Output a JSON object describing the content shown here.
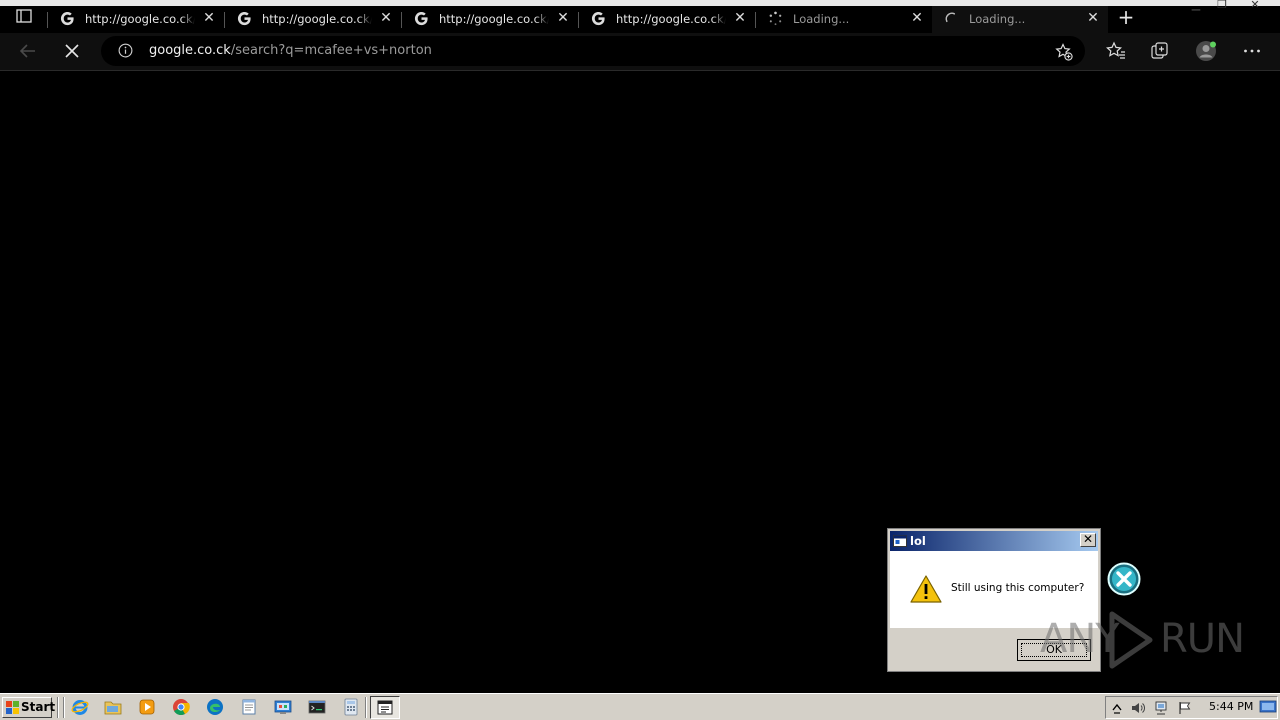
{
  "browser": {
    "tabs": [
      {
        "title": "http://google.co.ck/search?q=mcafee+vs+norton",
        "icon": "google-icon",
        "state": "loaded"
      },
      {
        "title": "http://google.co.ck/search?q=mcafee+vs+norton",
        "icon": "google-icon",
        "state": "loaded"
      },
      {
        "title": "http://google.co.ck/search?q=mcafee+vs+norton",
        "icon": "google-icon",
        "state": "loaded"
      },
      {
        "title": "http://google.co.ck/search?q=mcafee+vs+norton",
        "icon": "google-icon",
        "state": "loaded"
      },
      {
        "title": "Loading...",
        "icon": "loading-dots-icon",
        "state": "loading"
      },
      {
        "title": "Loading...",
        "icon": "loading-spinner-icon",
        "state": "loading",
        "active": true
      }
    ],
    "new_tab_label": "+",
    "address": {
      "host": "google.co.ck",
      "path": "/search?q=mcafee+vs+norton"
    },
    "colors": {
      "chrome_bg": "#0f0f0f",
      "page_bg": "#000000",
      "text": "#e6e6e6"
    }
  },
  "dialog": {
    "title": "lol",
    "message": "Still using this computer?",
    "ok_label": "OK",
    "close_glyph": "✕",
    "icon": "warning-icon",
    "colors": {
      "titlebar_start": "#0a246a",
      "titlebar_end": "#a6caf0",
      "face": "#d4d0c8"
    }
  },
  "watermark": {
    "left": "ANY",
    "right": "RUN"
  },
  "taskbar": {
    "start_label": "Start",
    "quick_launch": [
      "ie-icon",
      "folder-icon",
      "media-player-icon",
      "chrome-icon",
      "edge-icon",
      "notepad-icon",
      "control-panel-icon",
      "cmd-icon",
      "calculator-icon"
    ],
    "active_task_icon": "app-window-icon",
    "tray_icons": [
      "show-hidden-icon",
      "volume-icon",
      "network-icon",
      "action-center-flag-icon"
    ],
    "clock": "5:44 PM"
  }
}
